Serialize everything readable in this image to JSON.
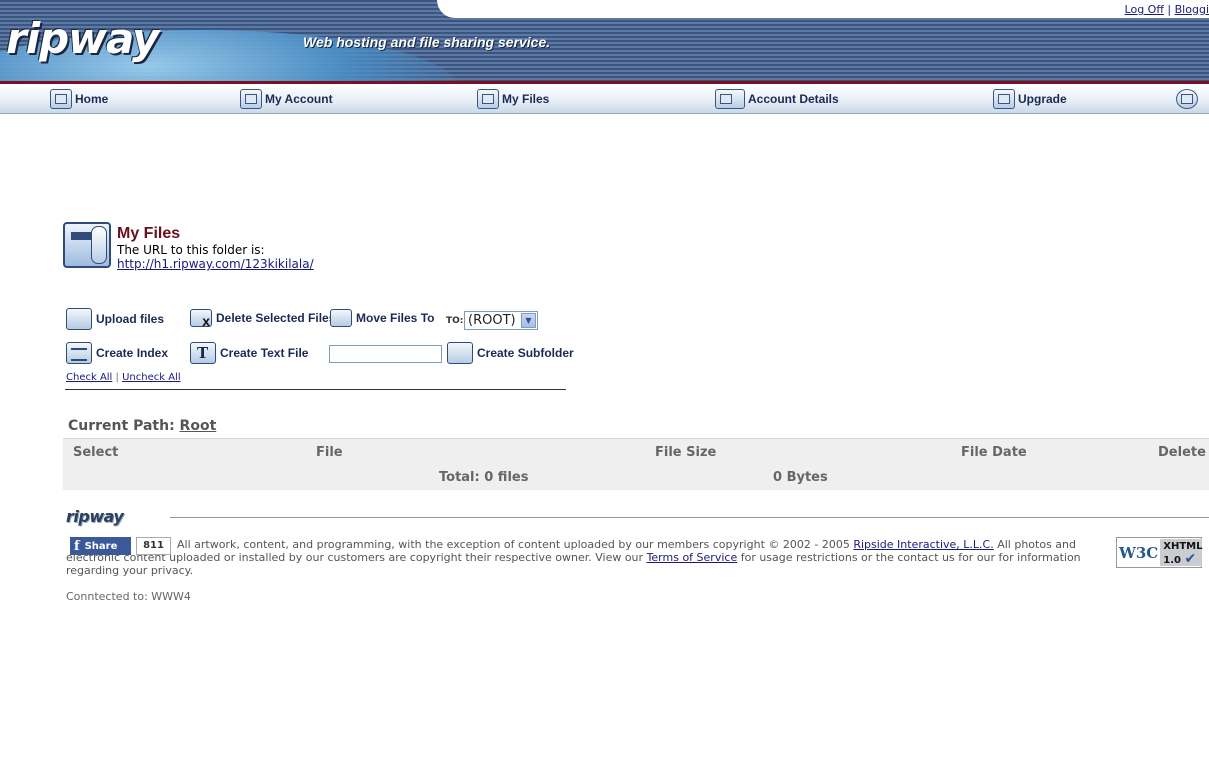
{
  "header": {
    "logo_text": "ripway",
    "tagline": "Web hosting and file sharing service.",
    "log_off": "Log Off",
    "separator": "|",
    "user_link": "Bloggi"
  },
  "nav": {
    "items": [
      {
        "label": "Home",
        "icon": "home-icon"
      },
      {
        "label": "My Account",
        "icon": "account-icon"
      },
      {
        "label": "My Files",
        "icon": "files-icon"
      },
      {
        "label": "Account Details",
        "icon": "details-icon"
      },
      {
        "label": "Upgrade",
        "icon": "upgrade-icon"
      }
    ]
  },
  "page": {
    "title": "My Files",
    "url_label": "The URL to this folder is:",
    "url": "http://h1.ripway.com/123kikilala/"
  },
  "toolbar": {
    "upload": "Upload files",
    "delete_selected": "Delete Selected Files",
    "move_files": "Move Files To",
    "to_label": "TO:",
    "destination": "(ROOT)",
    "create_index": "Create Index",
    "create_text_file": "Create Text File",
    "subfolder_value": "",
    "create_subfolder": "Create Subfolder",
    "check_all": "Check All",
    "check_sep": "|",
    "uncheck_all": "Uncheck All"
  },
  "files": {
    "current_path_label": "Current Path:",
    "current_path": "Root",
    "columns": [
      "Select",
      "File",
      "File Size",
      "File Date",
      "Delete"
    ],
    "total_files": "Total: 0 files",
    "total_size": "0 Bytes"
  },
  "footer": {
    "logo_text": "ripway",
    "share_label": "Share",
    "share_count": "811",
    "text_a": "All artwork, content, and programming, with the exception of content uploaded by our members copyright © 2002 - 2005 ",
    "company": "Ripside Interactive, L.L.C.",
    "text_b": " All photos and electronic content uploaded or installed by our customers are copyright their respective owner. View our ",
    "tos": "Terms of Service",
    "text_c": " for usage restrictions or the contact us for our for information regarding your privacy.",
    "w3c_left": "W3C",
    "w3c_right_1": "XHTML",
    "w3c_right_2": "1.0",
    "connected": "Conntected to: WWW4"
  }
}
